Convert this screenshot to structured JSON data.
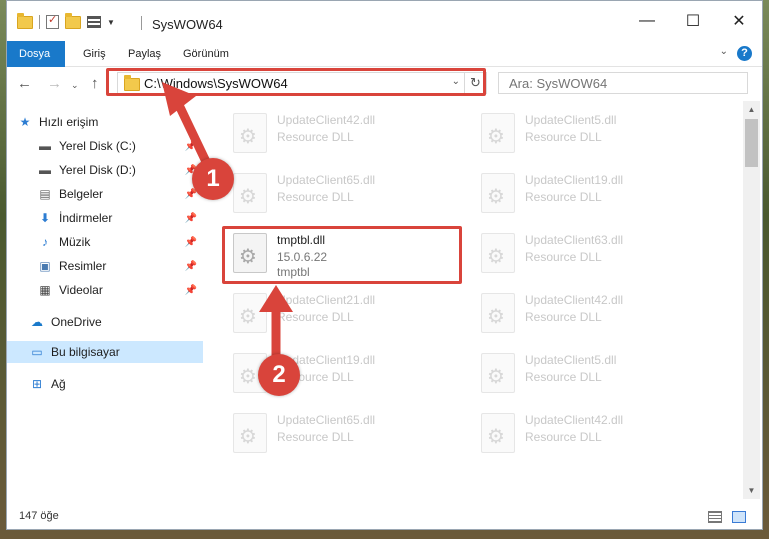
{
  "window": {
    "title": "SysWOW64",
    "min_glyph": "—",
    "max_glyph": "☐",
    "close_glyph": "✕"
  },
  "ribbon": {
    "tabs": [
      {
        "label": "Dosya",
        "active": true
      },
      {
        "label": "Giriş"
      },
      {
        "label": "Paylaş"
      },
      {
        "label": "Görünüm"
      }
    ],
    "expand_glyph": "⌄",
    "help_glyph": "?"
  },
  "nav": {
    "back_glyph": "←",
    "forward_glyph": "→",
    "up_glyph": "↑",
    "address": "C:\\Windows\\SysWOW64",
    "dropdown_glyph": "⌄",
    "refresh_glyph": "↻",
    "search_placeholder": "Ara: SysWOW64"
  },
  "sidebar": {
    "items": [
      {
        "label": "Hızlı erişim",
        "icon": "star-icon"
      },
      {
        "label": "Yerel Disk (C:)",
        "icon": "drive-icon",
        "pinned": true
      },
      {
        "label": "Yerel Disk (D:)",
        "icon": "drive-icon",
        "pinned": true
      },
      {
        "label": "Belgeler",
        "icon": "documents-icon",
        "pinned": true
      },
      {
        "label": "İndirmeler",
        "icon": "download-icon",
        "pinned": true
      },
      {
        "label": "Müzik",
        "icon": "music-icon",
        "pinned": true
      },
      {
        "label": "Resimler",
        "icon": "pictures-icon",
        "pinned": true
      },
      {
        "label": "Videolar",
        "icon": "videos-icon",
        "pinned": true
      },
      {
        "label": "OneDrive",
        "icon": "cloud-icon"
      },
      {
        "label": "Bu bilgisayar",
        "icon": "computer-icon",
        "selected": true
      },
      {
        "label": "Ağ",
        "icon": "network-icon"
      }
    ]
  },
  "files": {
    "col1": [
      {
        "name": "UpdateClient42.dll",
        "type": "Resource DLL"
      },
      {
        "name": "UpdateClient65.dll",
        "type": "Resource DLL"
      },
      {
        "name": "tmptbl.dll",
        "version": "15.0.6.22",
        "desc": "tmptbl"
      },
      {
        "name": "UpdateClient21.dll",
        "type": "Resource DLL"
      },
      {
        "name": "UpdateClient19.dll",
        "type": "Resource DLL"
      },
      {
        "name": "UpdateClient65.dll",
        "type": "Resource DLL"
      }
    ],
    "col2": [
      {
        "name": "UpdateClient5.dll",
        "type": "Resource DLL"
      },
      {
        "name": "UpdateClient19.dll",
        "type": "Resource DLL"
      },
      {
        "name": "UpdateClient63.dll",
        "type": "Resource DLL"
      },
      {
        "name": "UpdateClient42.dll",
        "type": "Resource DLL"
      },
      {
        "name": "UpdateClient5.dll",
        "type": "Resource DLL"
      },
      {
        "name": "UpdateClient42.dll",
        "type": "Resource DLL"
      }
    ]
  },
  "status": {
    "count": "147 öğe"
  },
  "annotations": {
    "step1": "1",
    "step2": "2",
    "color": "#d9443b"
  },
  "colors": {
    "accent": "#1979ca",
    "selected_bg": "#cce8ff",
    "highlight": "#d9443b"
  }
}
